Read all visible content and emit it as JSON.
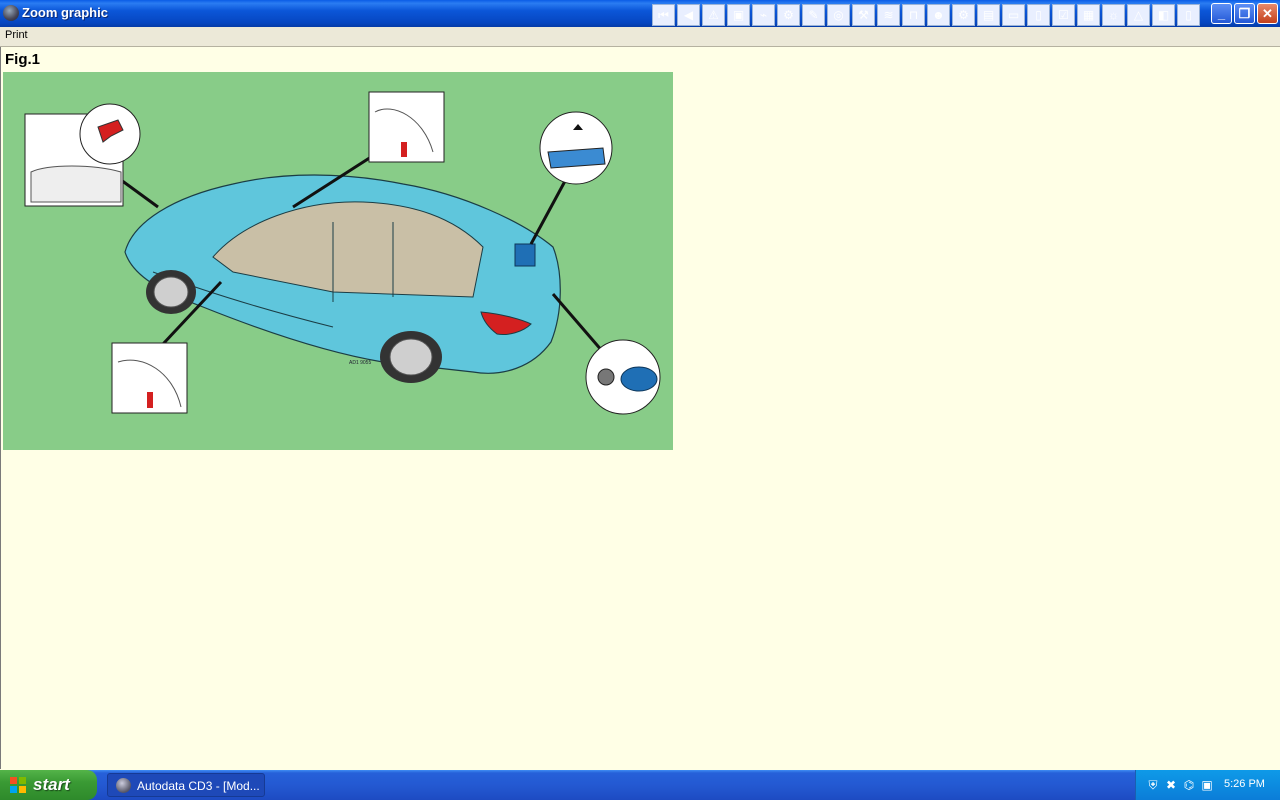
{
  "window": {
    "title": "Zoom graphic"
  },
  "toolbar": {
    "icons": [
      {
        "name": "first-page-icon",
        "glyph": "⏮"
      },
      {
        "name": "previous-icon",
        "glyph": "◀"
      },
      {
        "name": "warning-icon",
        "glyph": "⚠"
      },
      {
        "name": "engine-icon",
        "glyph": "▣"
      },
      {
        "name": "diagram-icon",
        "glyph": "⌁"
      },
      {
        "name": "gear-icon",
        "glyph": "⚙"
      },
      {
        "name": "tools-icon",
        "glyph": "✎"
      },
      {
        "name": "wheel-icon",
        "glyph": "◎"
      },
      {
        "name": "service-icon",
        "glyph": "⚒"
      },
      {
        "name": "belt-icon",
        "glyph": "≋"
      },
      {
        "name": "lift-icon",
        "glyph": "⊓"
      },
      {
        "name": "mechanic-icon",
        "glyph": "☻"
      },
      {
        "name": "wrench-icon",
        "glyph": "⚙"
      },
      {
        "name": "battery-icon",
        "glyph": "▤"
      },
      {
        "name": "car-icon",
        "glyph": "▭"
      },
      {
        "name": "manual-icon",
        "glyph": "▯"
      },
      {
        "name": "checklist-icon",
        "glyph": "☑"
      },
      {
        "name": "calendar-icon",
        "glyph": "▦"
      },
      {
        "name": "lamp-icon",
        "glyph": "☼"
      },
      {
        "name": "hazard-icon",
        "glyph": "△"
      },
      {
        "name": "vehicle-info-icon",
        "glyph": "◧"
      },
      {
        "name": "document-icon",
        "glyph": "▯"
      }
    ],
    "minimize": "_",
    "restore": "❐",
    "close": "✕"
  },
  "menu": {
    "print": "Print"
  },
  "figure": {
    "label": "Fig.1",
    "ref_code": "AD1 9055",
    "colors": {
      "background": "#88cc88",
      "car": "#5fc6dc",
      "interior": "#c9bfa6",
      "accent_red": "#d42020",
      "battery": "#1f6fb5"
    }
  },
  "taskbar": {
    "start_label": "start",
    "task_label": "Autodata CD3 - [Mod...",
    "clock": "5:26 PM"
  }
}
